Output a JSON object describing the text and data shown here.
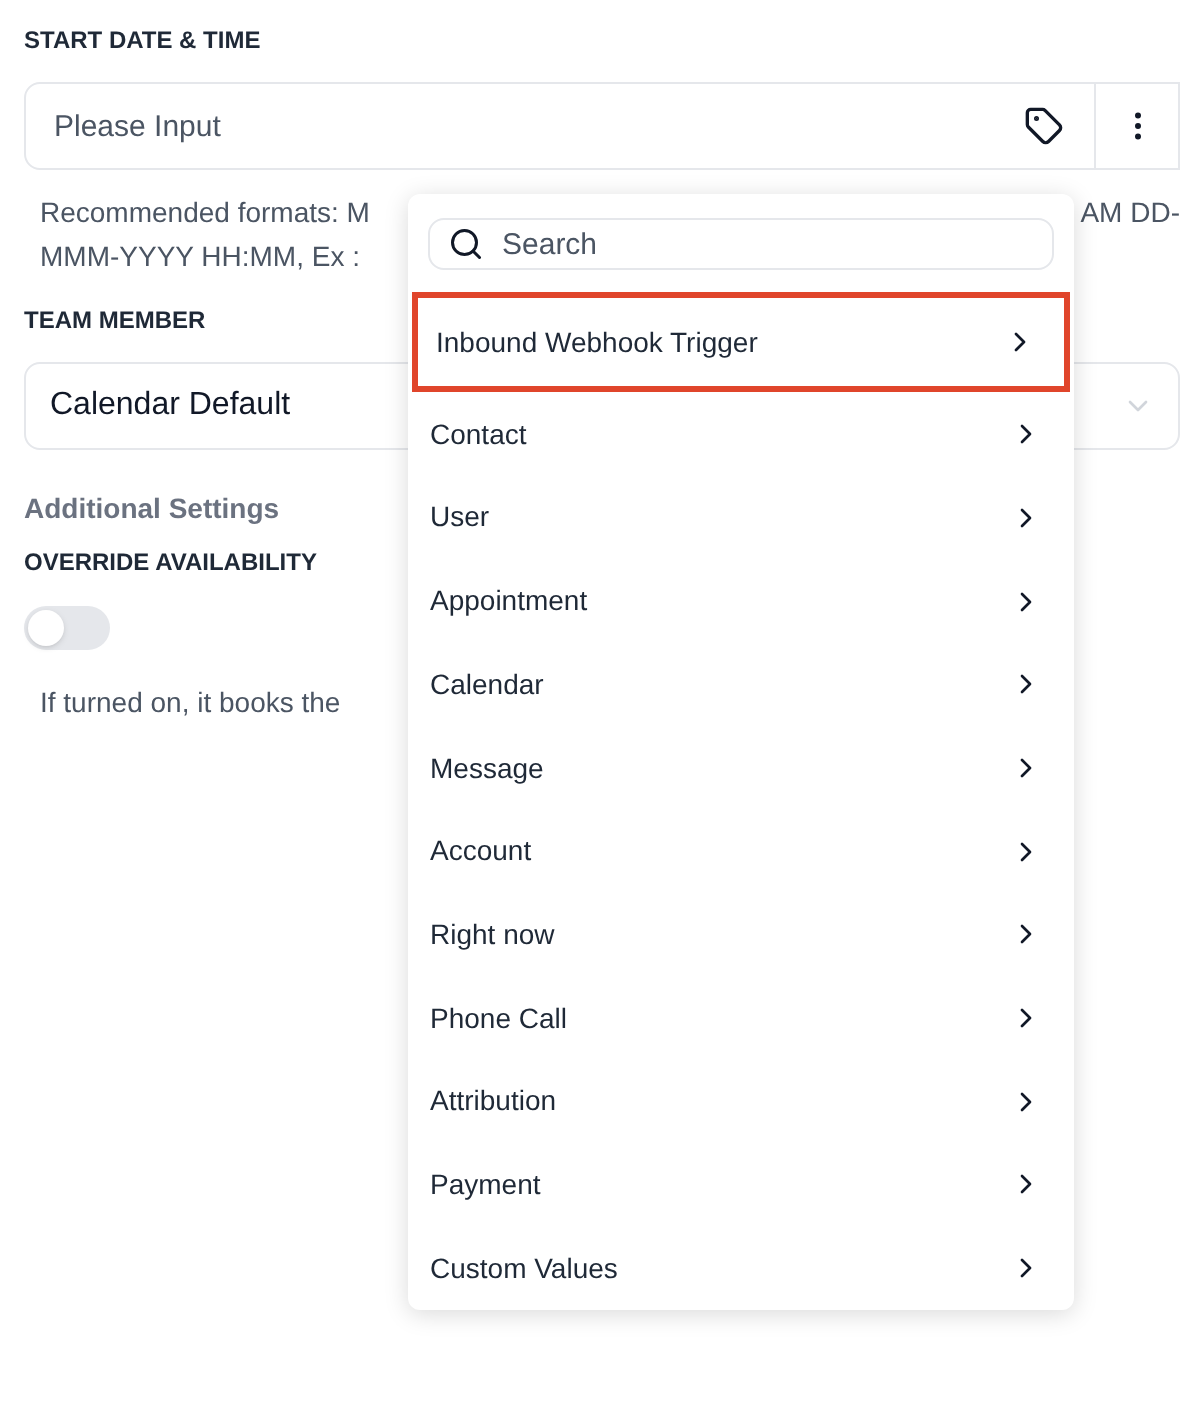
{
  "start": {
    "label": "START DATE & TIME",
    "placeholder": "Please Input",
    "hint_left": "Recommended formats: M",
    "hint_right": "AM DD-",
    "hint_line2": "MMM-YYYY HH:MM, Ex :"
  },
  "team": {
    "label": "TEAM MEMBER",
    "value": "Calendar Default"
  },
  "additional": {
    "title": "Additional Settings",
    "label": "OVERRIDE AVAILABILITY",
    "on": false,
    "description": "If turned on, it books the"
  },
  "menu": {
    "search_placeholder": "Search",
    "items": [
      {
        "label": "Inbound Webhook Trigger",
        "selected": true
      },
      {
        "label": "Contact",
        "selected": false
      },
      {
        "label": "User",
        "selected": false
      },
      {
        "label": "Appointment",
        "selected": false
      },
      {
        "label": "Calendar",
        "selected": false
      },
      {
        "label": "Message",
        "selected": false
      },
      {
        "label": "Account",
        "selected": false
      },
      {
        "label": "Right now",
        "selected": false
      },
      {
        "label": "Phone Call",
        "selected": false
      },
      {
        "label": "Attribution",
        "selected": false
      },
      {
        "label": "Payment",
        "selected": false
      },
      {
        "label": "Custom Values",
        "selected": false
      }
    ]
  }
}
